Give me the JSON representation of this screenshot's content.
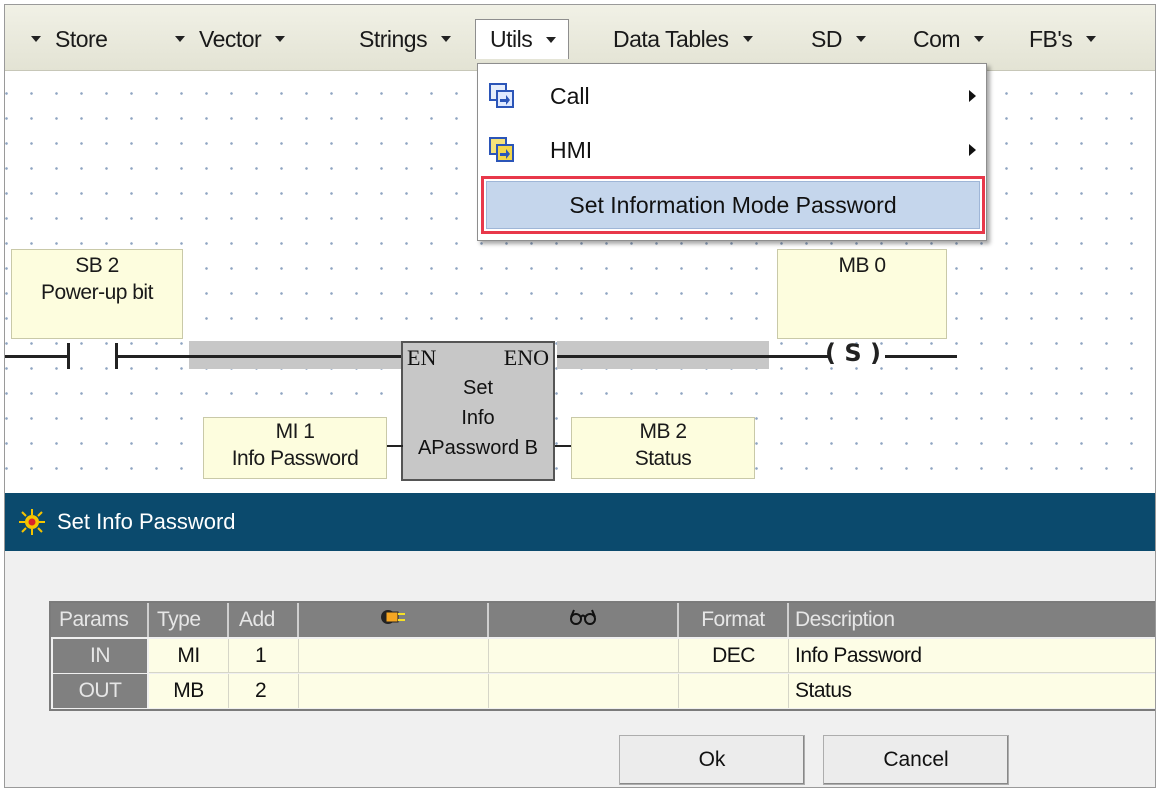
{
  "menubar": {
    "items": [
      {
        "label": "Store"
      },
      {
        "label": "Vector"
      },
      {
        "label": "Strings"
      },
      {
        "label": "Utils"
      },
      {
        "label": "Data Tables"
      },
      {
        "label": "SD"
      },
      {
        "label": "Com"
      },
      {
        "label": "FB's"
      }
    ],
    "open_item": "Utils"
  },
  "dropdown": {
    "items": [
      {
        "label": "Call",
        "icon": "call-icon",
        "has_submenu": true
      },
      {
        "label": "HMI",
        "icon": "hmi-icon",
        "has_submenu": true
      },
      {
        "label": "Set Information Mode Password",
        "highlighted": true
      }
    ],
    "highlight_color": "#e8384a"
  },
  "ladder": {
    "contact": {
      "line1": "SB 2",
      "line2": "Power-up bit"
    },
    "coil_operand": {
      "line1": "MB 0"
    },
    "coil_symbol": "( S )",
    "function_block": {
      "en": "EN",
      "eno": "ENO",
      "line1": "Set",
      "line2": "Info",
      "line3": "APassword B"
    },
    "input_operand": {
      "line1": "MI 1",
      "line2": "Info Password"
    },
    "output_operand": {
      "line1": "MB 2",
      "line2": "Status"
    }
  },
  "dialog": {
    "title": "Set Info Password",
    "title_bar_color": "#0b4a6d",
    "columns": [
      "Params",
      "Type",
      "Add",
      "",
      "",
      "Format",
      "Description"
    ],
    "column_icons": [
      "",
      "",
      "",
      "plug-icon",
      "glasses-icon",
      "",
      ""
    ],
    "rows": [
      {
        "param": "IN",
        "type": "MI",
        "add": "1",
        "format": "DEC",
        "description": "Info Password"
      },
      {
        "param": "OUT",
        "type": "MB",
        "add": "2",
        "format": "",
        "description": "Status"
      }
    ],
    "ok_label": "Ok",
    "cancel_label": "Cancel"
  }
}
